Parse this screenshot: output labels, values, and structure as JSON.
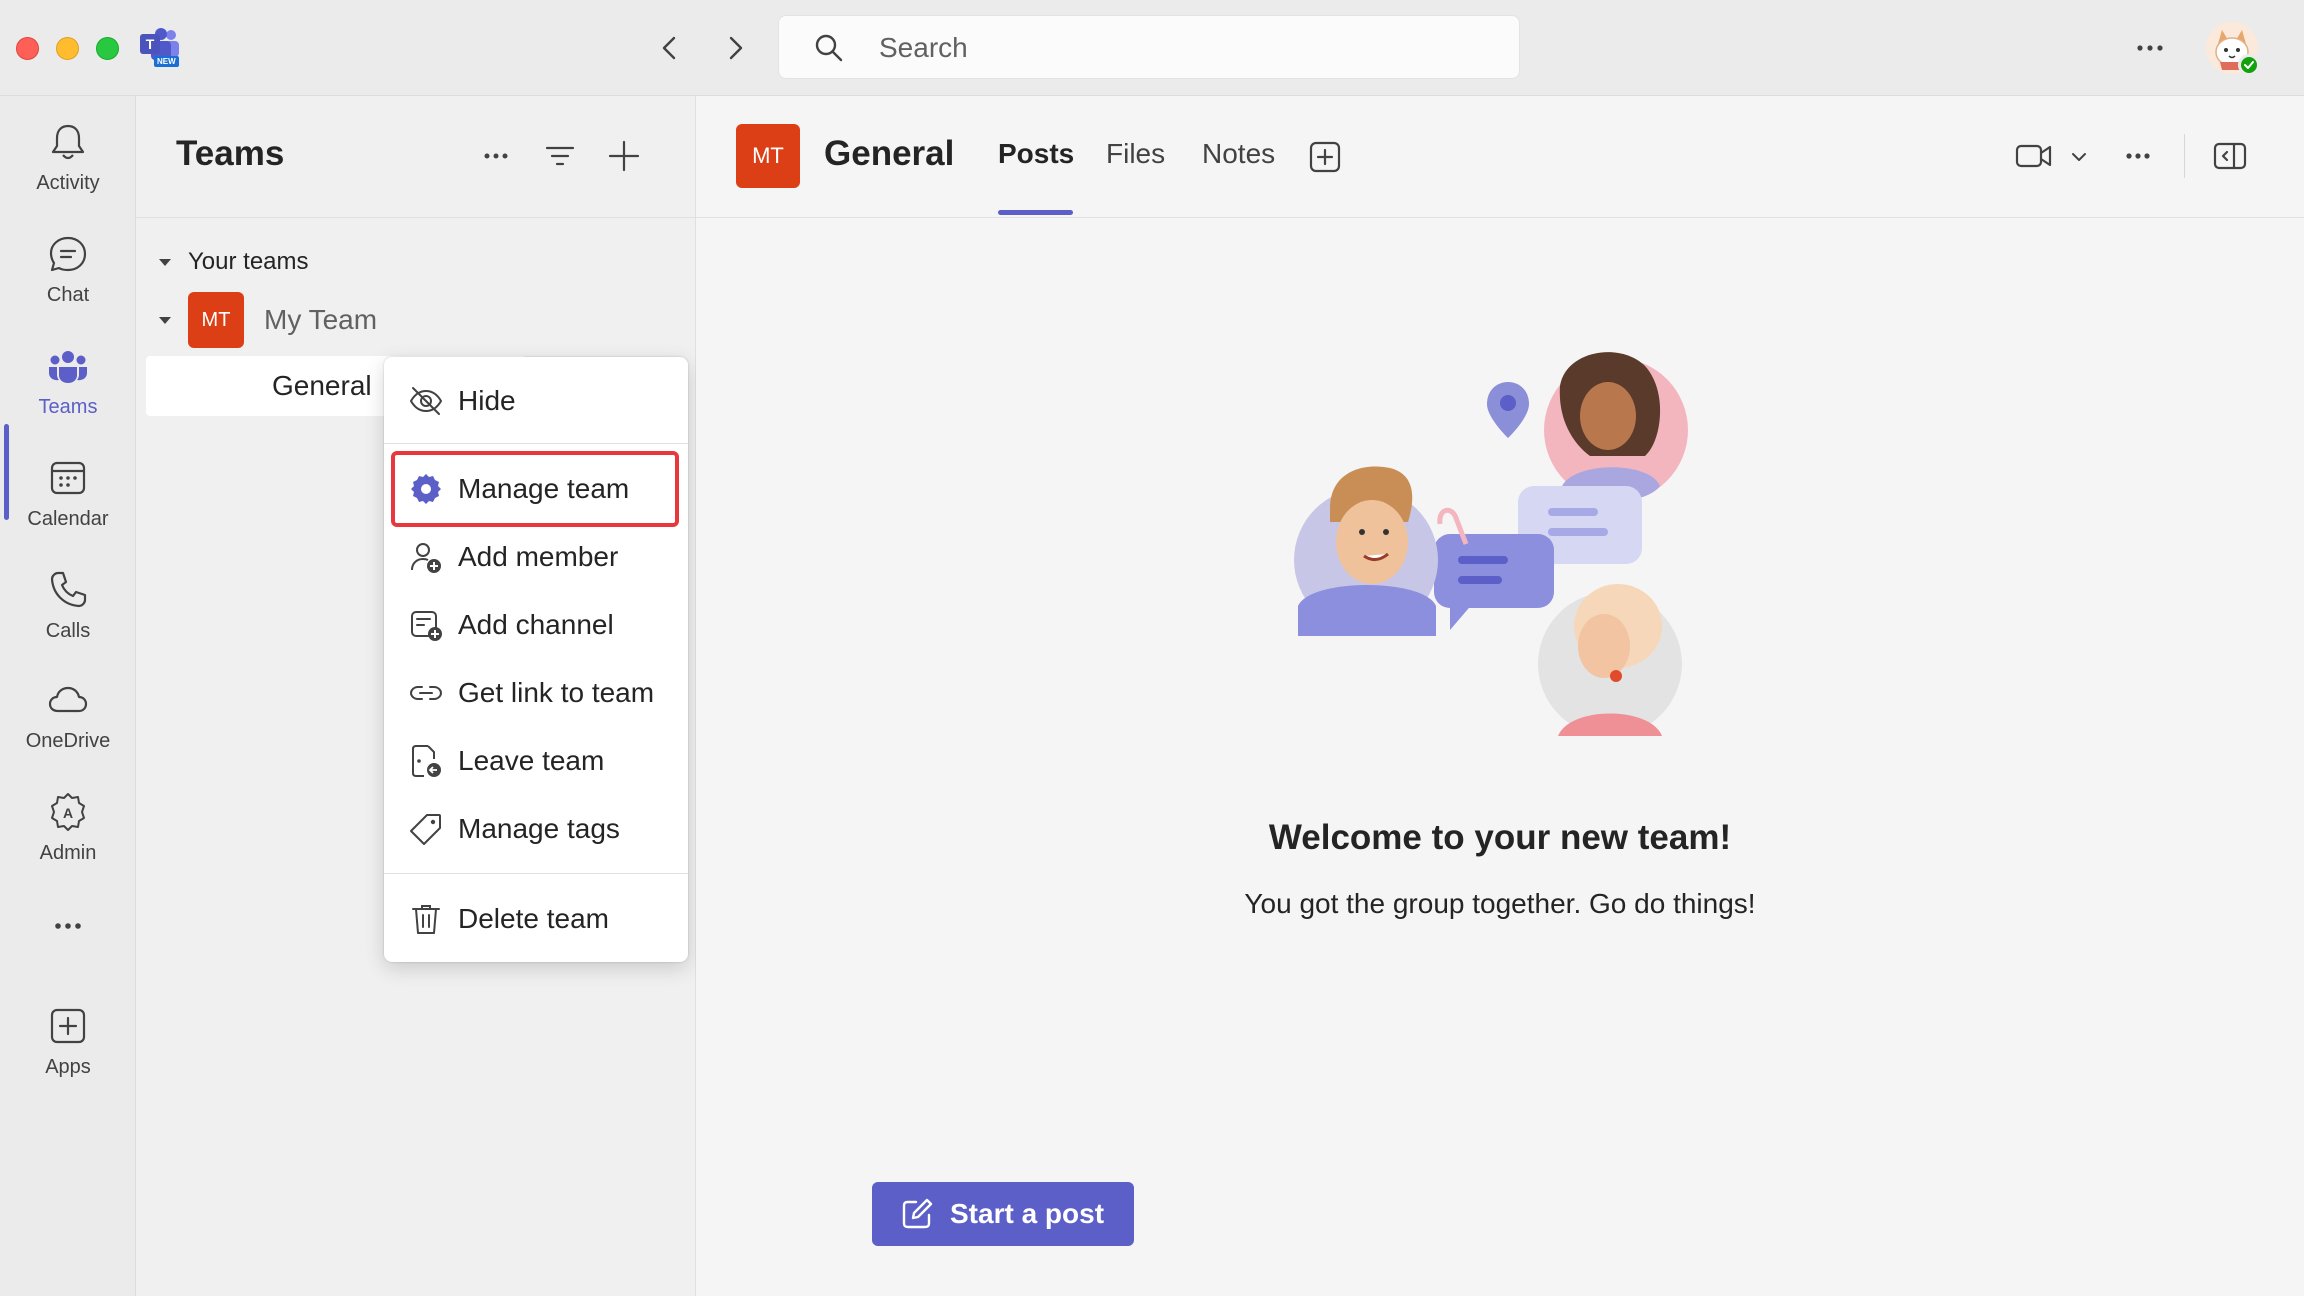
{
  "titlebar": {
    "search_placeholder": "Search",
    "logo_badge": "NEW"
  },
  "rail": {
    "items": [
      {
        "label": "Activity",
        "icon": "bell-icon"
      },
      {
        "label": "Chat",
        "icon": "chat-icon"
      },
      {
        "label": "Teams",
        "icon": "teams-icon",
        "active": true
      },
      {
        "label": "Calendar",
        "icon": "calendar-icon"
      },
      {
        "label": "Calls",
        "icon": "phone-icon"
      },
      {
        "label": "OneDrive",
        "icon": "cloud-icon"
      },
      {
        "label": "Admin",
        "icon": "admin-icon"
      },
      {
        "label": "",
        "icon": "more-icon"
      },
      {
        "label": "Apps",
        "icon": "add-apps-icon"
      }
    ]
  },
  "teams_panel": {
    "title": "Teams",
    "section_label": "Your teams",
    "team": {
      "initials": "MT",
      "name": "My Team"
    },
    "channel": {
      "name": "General"
    }
  },
  "context_menu": {
    "items": [
      {
        "label": "Hide",
        "icon": "hide-eye-icon"
      },
      {
        "label": "Manage team",
        "icon": "gear-icon",
        "highlighted": true
      },
      {
        "label": "Add member",
        "icon": "add-person-icon"
      },
      {
        "label": "Add channel",
        "icon": "add-channel-icon"
      },
      {
        "label": "Get link to team",
        "icon": "link-icon"
      },
      {
        "label": "Leave team",
        "icon": "leave-icon"
      },
      {
        "label": "Manage tags",
        "icon": "tag-icon"
      },
      {
        "label": "Delete team",
        "icon": "trash-icon"
      }
    ]
  },
  "channel_header": {
    "initials": "MT",
    "name": "General",
    "tabs": [
      "Posts",
      "Files",
      "Notes"
    ],
    "active_tab": "Posts"
  },
  "welcome": {
    "title": "Welcome to your new team!",
    "subtitle": "You got the group together. Go do things!"
  },
  "compose": {
    "start_post_label": "Start a post"
  },
  "colors": {
    "accent": "#5b5fc7",
    "team_avatar": "#dc3e15",
    "highlight": "#e8383d",
    "presence": "#13a10e"
  }
}
